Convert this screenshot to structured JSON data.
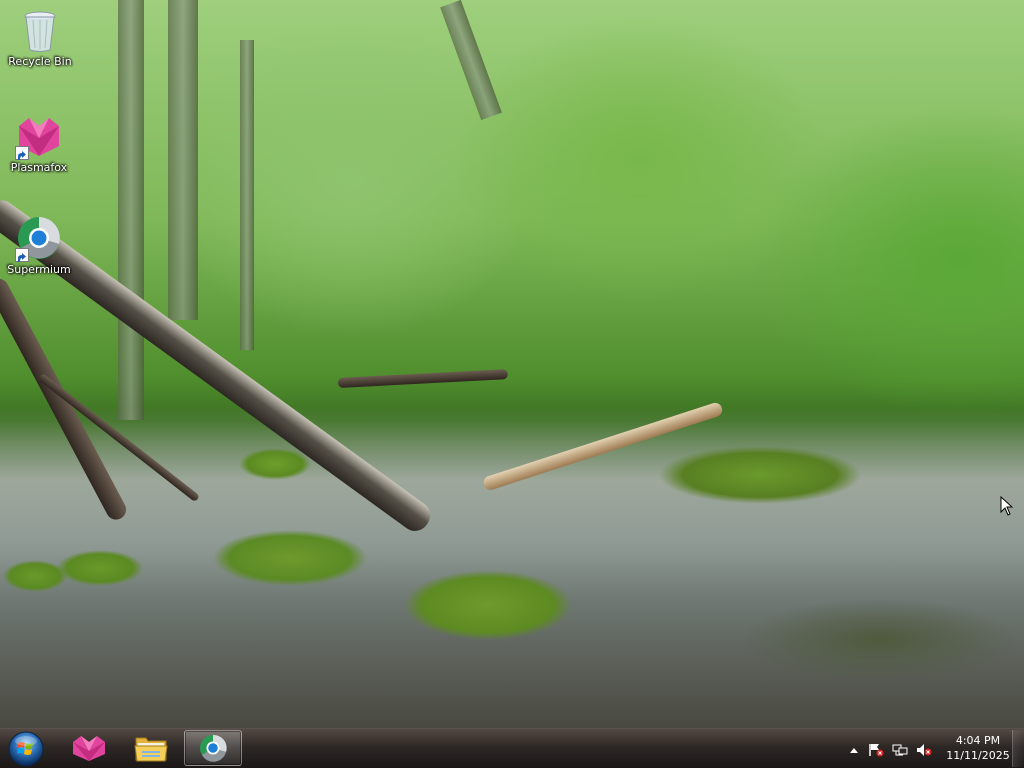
{
  "desktop": {
    "icons": [
      {
        "label": "Recycle Bin",
        "icon": "recycle-bin-icon"
      },
      {
        "label": "Plasmafox",
        "icon": "plasmafox-icon"
      },
      {
        "label": "Supermium",
        "icon": "supermium-icon"
      }
    ]
  },
  "taskbar": {
    "start_icon": "windows-start-orb-icon",
    "pinned": [
      {
        "name": "Plasmafox",
        "icon": "plasmafox-icon"
      },
      {
        "name": "Windows Explorer",
        "icon": "folder-icon"
      },
      {
        "name": "Supermium",
        "icon": "supermium-icon",
        "active": true
      }
    ],
    "tray": {
      "icons": [
        "show-hidden-icons-arrow",
        "action-center-flag-icon",
        "network-icon",
        "volume-muted-icon"
      ],
      "time": "4:04 PM",
      "date": "11/11/2025"
    }
  },
  "colors": {
    "plasmafox": "#e0449c",
    "supermium": "#1e7fd6",
    "taskbar": "#221c1a"
  }
}
